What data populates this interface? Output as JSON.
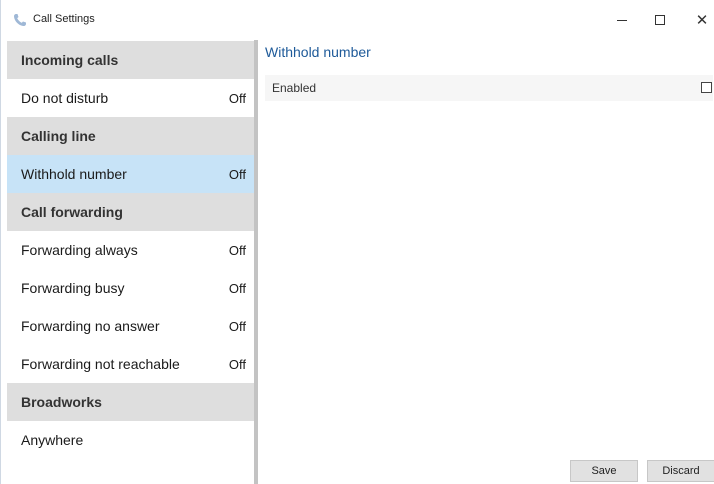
{
  "window": {
    "title": "Call Settings",
    "app_icon": "phone-icon",
    "controls": {
      "minimize": "minimize-icon",
      "maximize": "maximize-icon",
      "close": "close-icon"
    }
  },
  "sidebar": {
    "rows": [
      {
        "kind": "header",
        "label": "Incoming calls",
        "value": ""
      },
      {
        "kind": "item",
        "label": "Do not disturb",
        "value": "Off",
        "selected": false
      },
      {
        "kind": "header",
        "label": "Calling line",
        "value": ""
      },
      {
        "kind": "item",
        "label": "Withhold number",
        "value": "Off",
        "selected": true
      },
      {
        "kind": "header",
        "label": "Call forwarding",
        "value": ""
      },
      {
        "kind": "item",
        "label": "Forwarding always",
        "value": "Off",
        "selected": false
      },
      {
        "kind": "item",
        "label": "Forwarding busy",
        "value": "Off",
        "selected": false
      },
      {
        "kind": "item",
        "label": "Forwarding no answer",
        "value": "Off",
        "selected": false
      },
      {
        "kind": "item",
        "label": "Forwarding not reachable",
        "value": "Off",
        "selected": false
      },
      {
        "kind": "header",
        "label": "Broadworks",
        "value": ""
      },
      {
        "kind": "item",
        "label": "Anywhere",
        "value": "",
        "selected": false
      }
    ]
  },
  "main": {
    "title": "Withhold number",
    "setting": {
      "label": "Enabled",
      "checked": false
    }
  },
  "buttons": {
    "save": "Save",
    "discard": "Discard"
  },
  "colors": {
    "selected": "#c7e3f7",
    "header": "#dedede",
    "title": "#1e5a99"
  }
}
